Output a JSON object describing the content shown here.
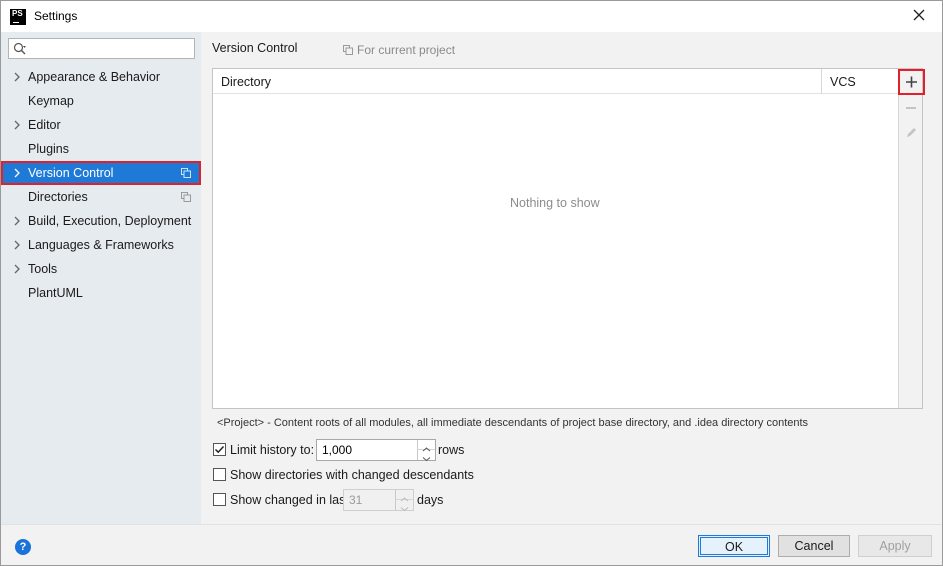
{
  "window": {
    "title": "Settings",
    "app_icon_text": "PS",
    "close_icon": "close-icon"
  },
  "sidebar": {
    "search": {
      "value": "",
      "placeholder": ""
    },
    "items": [
      {
        "label": "Appearance & Behavior",
        "expandable": true,
        "selected": false,
        "project_scoped": false
      },
      {
        "label": "Keymap",
        "expandable": false,
        "selected": false,
        "project_scoped": false
      },
      {
        "label": "Editor",
        "expandable": true,
        "selected": false,
        "project_scoped": false
      },
      {
        "label": "Plugins",
        "expandable": false,
        "selected": false,
        "project_scoped": false
      },
      {
        "label": "Version Control",
        "expandable": true,
        "selected": true,
        "project_scoped": true
      },
      {
        "label": "Directories",
        "expandable": false,
        "selected": false,
        "project_scoped": true
      },
      {
        "label": "Build, Execution, Deployment",
        "expandable": true,
        "selected": false,
        "project_scoped": false
      },
      {
        "label": "Languages & Frameworks",
        "expandable": true,
        "selected": false,
        "project_scoped": false
      },
      {
        "label": "Tools",
        "expandable": true,
        "selected": false,
        "project_scoped": false
      },
      {
        "label": "PlantUML",
        "expandable": false,
        "selected": false,
        "project_scoped": false
      }
    ]
  },
  "main": {
    "title": "Version Control",
    "scope_label": "For current project",
    "table": {
      "columns": [
        "Directory",
        "VCS"
      ],
      "rows": [],
      "empty_text": "Nothing to show"
    },
    "toolbar": {
      "add": "add-icon",
      "remove": "remove-icon",
      "edit": "edit-icon"
    },
    "hint": "<Project> - Content roots of all modules, all immediate descendants of project base directory, and .idea directory contents",
    "options": {
      "limit_history": {
        "label": "Limit history to:",
        "checked": true,
        "value": "1,000",
        "unit": "rows"
      },
      "show_dirs": {
        "label": "Show directories with changed descendants",
        "checked": false
      },
      "show_changed": {
        "label": "Show changed in last",
        "checked": false,
        "value": "31",
        "unit": "days"
      }
    }
  },
  "footer": {
    "help_label": "?",
    "ok_label": "OK",
    "cancel_label": "Cancel",
    "apply_label": "Apply"
  },
  "colors": {
    "selection": "#1e7ad6",
    "highlight_border": "#e0202a",
    "sidebar_bg": "#e6ebf0",
    "help_blue": "#1a73d9"
  }
}
